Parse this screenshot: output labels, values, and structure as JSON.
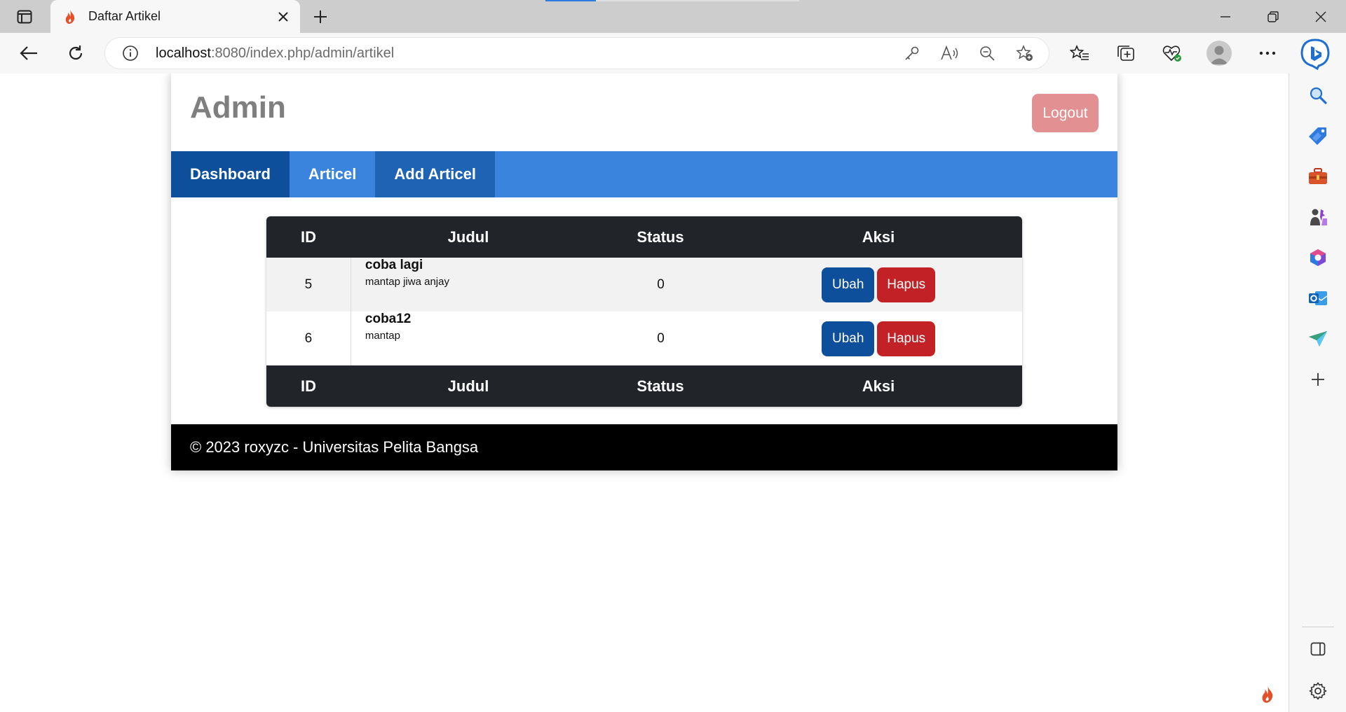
{
  "browser": {
    "tab": {
      "title": "Daftar Artikel"
    },
    "address": {
      "host": "localhost",
      "path": ":8080/index.php/admin/artikel"
    }
  },
  "page": {
    "title": "Admin",
    "logout_label": "Logout",
    "menu": [
      {
        "label": "Dashboard"
      },
      {
        "label": "Articel"
      },
      {
        "label": "Add Articel"
      }
    ],
    "table": {
      "headers": [
        "ID",
        "Judul",
        "Status",
        "Aksi"
      ],
      "rows": [
        {
          "id": "5",
          "title": "coba lagi",
          "subtitle": "mantap jiwa anjay",
          "status": "0",
          "edit_label": "Ubah",
          "delete_label": "Hapus"
        },
        {
          "id": "6",
          "title": "coba12",
          "subtitle": "mantap",
          "status": "0",
          "edit_label": "Ubah",
          "delete_label": "Hapus"
        }
      ]
    },
    "footer": "© 2023 roxyzc - Universitas Pelita Bangsa"
  },
  "colors": {
    "menu_bar": "#3a84dd",
    "menu_active": "#0d4f9b",
    "logout": "#e29091",
    "btn_ubah": "#0d4f9b",
    "btn_hapus": "#c22226",
    "table_header": "#212529",
    "footer": "#000000"
  },
  "icons": {
    "sidebar": [
      "search-icon",
      "tag-icon",
      "toolbox-icon",
      "games-icon",
      "office-icon",
      "outlook-icon",
      "send-icon",
      "add-icon",
      "sidebar-toggle-icon",
      "settings-icon"
    ]
  }
}
